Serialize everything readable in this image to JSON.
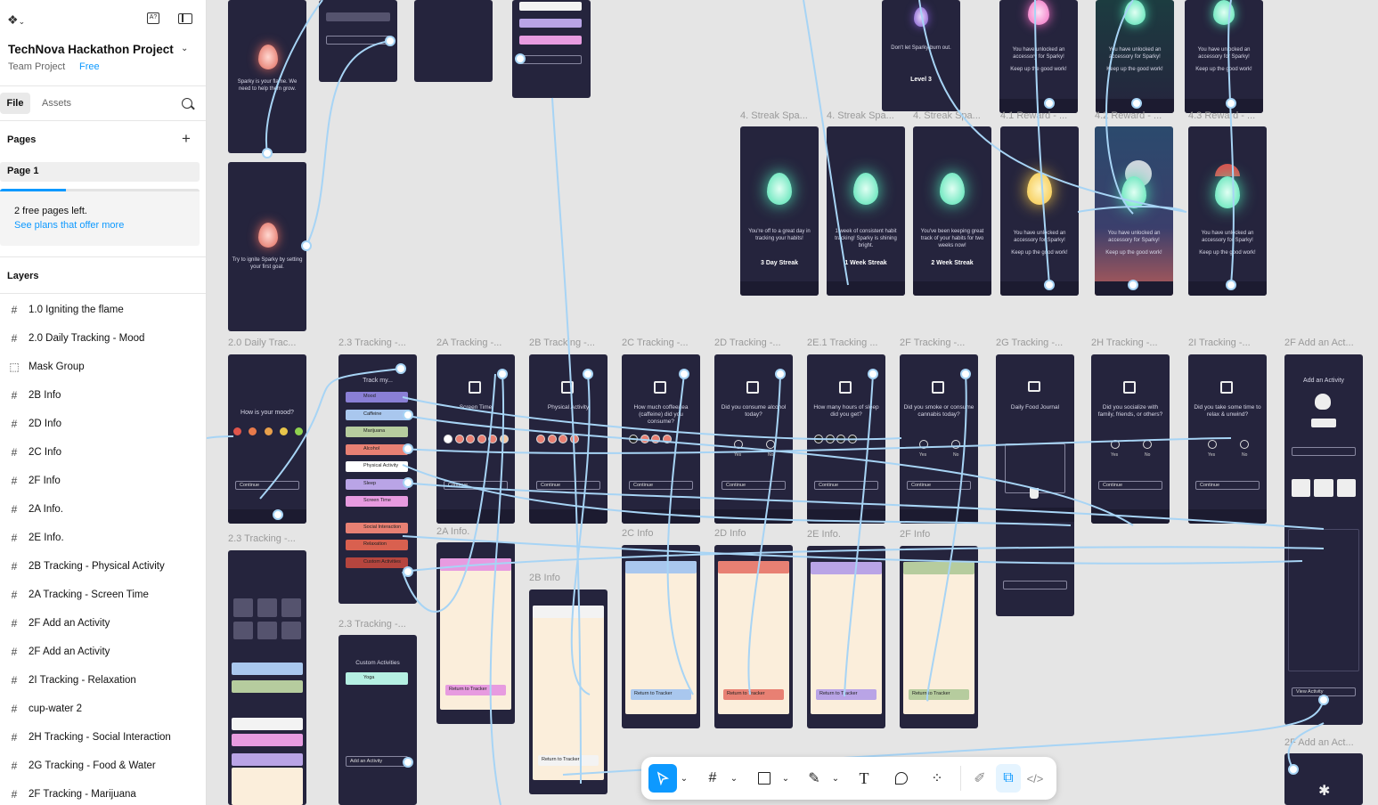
{
  "file": {
    "name": "TechNova Hackathon Project",
    "team": "Team Project",
    "plan": "Free"
  },
  "tabs": {
    "file": "File",
    "assets": "Assets"
  },
  "pages": {
    "heading": "Pages",
    "current": "Page 1"
  },
  "upsell": {
    "line": "2 free pages left.",
    "link": "See plans that offer more"
  },
  "layers_heading": "Layers",
  "layers": [
    {
      "name": "1.0 Igniting the flame",
      "icon": "#"
    },
    {
      "name": "2.0 Daily Tracking - Mood",
      "icon": "#"
    },
    {
      "name": "Mask Group",
      "icon": "⬚"
    },
    {
      "name": "2B Info",
      "icon": "#"
    },
    {
      "name": "2D Info",
      "icon": "#"
    },
    {
      "name": "2C Info",
      "icon": "#"
    },
    {
      "name": "2F Info",
      "icon": "#"
    },
    {
      "name": "2A Info.",
      "icon": "#"
    },
    {
      "name": "2E Info.",
      "icon": "#"
    },
    {
      "name": "2B Tracking - Physical Activity",
      "icon": "#"
    },
    {
      "name": "2A Tracking - Screen Time",
      "icon": "#"
    },
    {
      "name": "2F Add an Activity",
      "icon": "#"
    },
    {
      "name": "2F Add an Activity",
      "icon": "#"
    },
    {
      "name": "2I Tracking - Relaxation",
      "icon": "#"
    },
    {
      "name": "cup-water 2",
      "icon": "#"
    },
    {
      "name": "2H Tracking - Social Interaction",
      "icon": "#"
    },
    {
      "name": "2G Tracking - Food & Water",
      "icon": "#"
    },
    {
      "name": "2F Tracking - Marijuana",
      "icon": "#"
    }
  ],
  "canvas": {
    "labels": {
      "streak1": "4. Streak Spa...",
      "streak2": "4. Streak Spa...",
      "streak3": "4. Streak Spa...",
      "reward1": "4.1 Reward - ...",
      "reward2": "4.2 Reward - ...",
      "reward3": "4.3 Reward - ...",
      "daily": "2.0 Daily Trac...",
      "track23": "2.3 Tracking -...",
      "t2a": "2A Tracking -...",
      "t2b": "2B Tracking -...",
      "t2c": "2C Tracking -...",
      "t2d": "2D Tracking -...",
      "t2e": "2E.1 Tracking ...",
      "t2f": "2F Tracking -...",
      "t2g": "2G Tracking -...",
      "t2h": "2H Tracking -...",
      "t2i": "2I Tracking -...",
      "add1": "2F Add an Act...",
      "track23b": "2.3 Tracking -...",
      "track23c": "2.3 Tracking -...",
      "info2a": "2A Info.",
      "info2b": "2B Info",
      "info2c": "2C Info",
      "info2d": "2D Info",
      "info2e": "2E Info.",
      "info2f": "2F Info",
      "add2": "2F Add an Act..."
    },
    "streaks": [
      "3 Day Streak",
      "1 Week Streak",
      "2 Week Streak"
    ],
    "streak_msgs": [
      "You're off to a great day in tracking your habits!",
      "1 week of consistent habit tracking! Sparky is shining bright.",
      "You've been keeping great track of your habits for two weeks now!"
    ],
    "reward_msg": "You have unlocked an accessory for Sparky!",
    "reward_sub": "Keep up the good work!",
    "level": "Level 3",
    "burnout": "Don't let Sparky burn out.",
    "sparky_intro": "Sparky is your flame. We need to help them grow.",
    "ignite": "Try to ignite Sparky by setting your first goal.",
    "mood_q": "How is your mood?",
    "track_title": "Track my...",
    "track_items": [
      "Mood",
      "Caffeine",
      "Marijuana",
      "Alcohol",
      "Physical Activity",
      "Sleep",
      "Screen Time",
      "Social Interaction",
      "Relaxation",
      "Custom Activities"
    ],
    "screen_time": "Screen Time",
    "physical": "Physical Activity",
    "caffeine_q": "How much coffee/tea (caffeine) did you consume?",
    "alcohol_q": "Did you consume alcohol today?",
    "sleep_q": "How many hours of sleep did you get?",
    "cannabis_q": "Did you smoke or consume cannabis today?",
    "food": "Daily Food Journal",
    "social_q": "Did you socialize with family, friends, or others?",
    "relax_q": "Did you take some time to relax & unwind?",
    "add_title": "Add an Activity",
    "continue": "Continue",
    "return": "Return to Tracker",
    "custom_title": "Custom Activities",
    "custom_item": "Yoga",
    "add_activity_btn": "Add an Activity",
    "view_activity": "View Activity",
    "yes": "Yes",
    "no": "No"
  },
  "toolbar": {
    "tools": [
      "move-tool",
      "frame-tool",
      "shape-tool",
      "pen-tool",
      "text-tool",
      "comment-tool",
      "actions-tool",
      "draw-mode",
      "design-mode",
      "dev-mode"
    ]
  },
  "colors": {
    "accent": "#0d99ff",
    "frame_bg": "#25243d",
    "flame": "#4de0b0",
    "link": "#a7d4f5"
  }
}
